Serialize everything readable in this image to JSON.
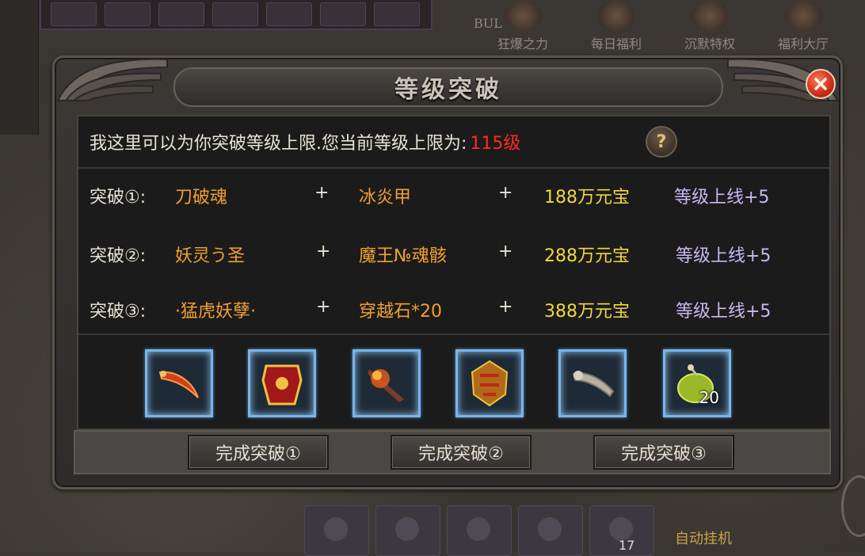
{
  "background": {
    "top_labels": [
      "狂爆之力",
      "每日福利",
      "沉默特权",
      "福利大厅"
    ],
    "bul_text": "BUL",
    "bottom_count": "17",
    "autoplay_label": "自动挂机"
  },
  "dialog": {
    "title": "等级突破",
    "info_text": "我这里可以为你突破等级上限.您当前等级上限为:",
    "level_limit": "115级",
    "help_symbol": "?",
    "recipes": [
      {
        "label": "突破①:",
        "item1": "刀破魂",
        "plus1": "+",
        "item2": "冰炎甲",
        "plus2": "+",
        "cost": "188万元宝",
        "reward": "等级上线+5"
      },
      {
        "label": "突破②:",
        "item1": "妖灵う圣",
        "plus1": "+",
        "item2": "魔王№魂骸",
        "plus2": "+",
        "cost": "288万元宝",
        "reward": "等级上线+5"
      },
      {
        "label": "突破③:",
        "item1": "·猛虎妖孽·",
        "plus1": "+",
        "item2": "穿越石*20",
        "plus2": "+",
        "cost": "388万元宝",
        "reward": "等级上线+5"
      }
    ],
    "item_slots": [
      {
        "icon": "blade-icon",
        "count": ""
      },
      {
        "icon": "armor-icon",
        "count": ""
      },
      {
        "icon": "fire-sword-icon",
        "count": ""
      },
      {
        "icon": "demon-armor-icon",
        "count": ""
      },
      {
        "icon": "bone-skull-icon",
        "count": ""
      },
      {
        "icon": "travel-stone-icon",
        "count": "20"
      }
    ],
    "buttons": [
      "完成突破①",
      "完成突破②",
      "完成突破③"
    ]
  },
  "colors": {
    "level_limit": "#ff2a1e",
    "item_name": "#f0a030",
    "cost": "#f0d840",
    "reward": "#c9b8f2",
    "slot_border": "#7ab4e8"
  }
}
